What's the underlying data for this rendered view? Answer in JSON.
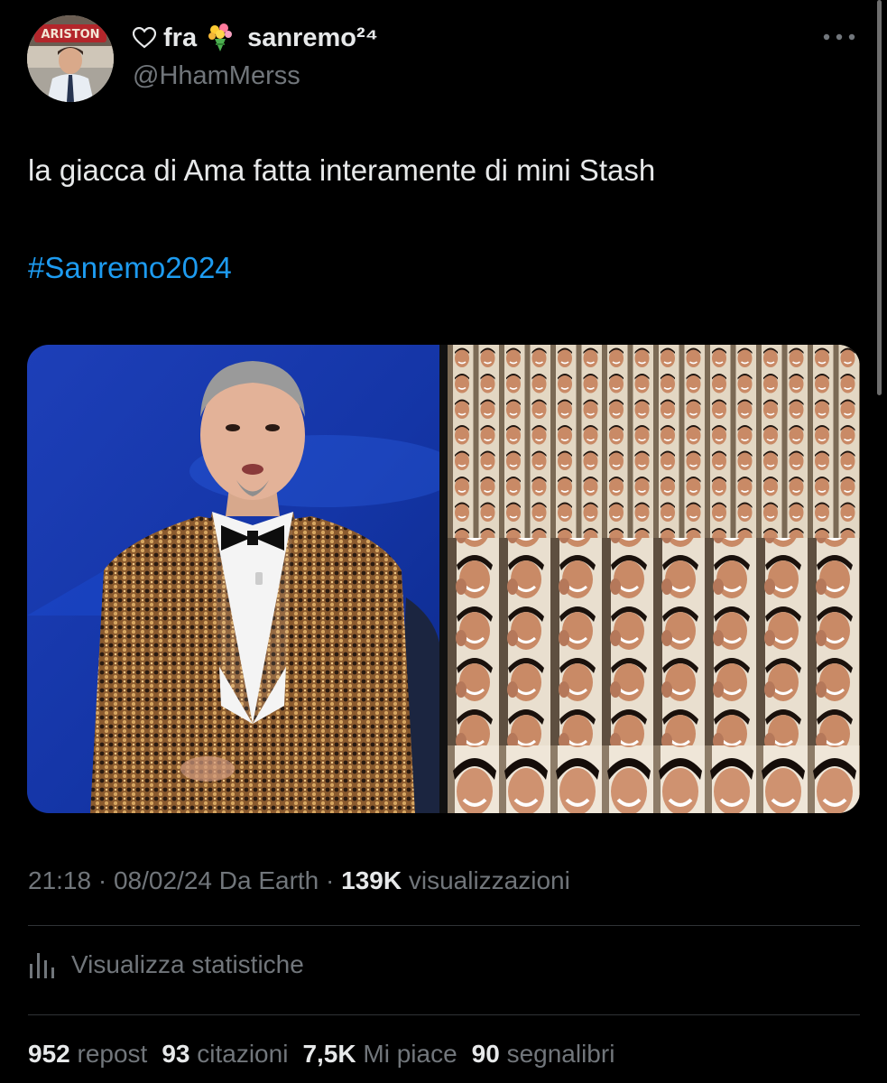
{
  "author": {
    "display_name_prefix": "fra",
    "display_name_suffix": "sanremo²⁴",
    "handle": "@HhamMerss",
    "avatar_sign_text": "ARISTON"
  },
  "tweet": {
    "text": "la giacca di Ama fatta interamente di mini Stash",
    "hashtag": "#Sanremo2024"
  },
  "meta": {
    "time": "21:18",
    "date": "08/02/24",
    "source": "Da Earth",
    "views_count": "139K",
    "views_label": "visualizzazioni",
    "separator": "·"
  },
  "actions": {
    "view_stats_label": "Visualizza statistiche"
  },
  "counts": {
    "reposts_value": "952",
    "reposts_label": "repost",
    "quotes_value": "93",
    "quotes_label": "citazioni",
    "likes_value": "7,5K",
    "likes_label": "Mi piace",
    "bookmarks_value": "90",
    "bookmarks_label": "segnalibri"
  },
  "colors": {
    "background": "#000000",
    "primary_text": "#e7e9ea",
    "secondary_text": "#71767b",
    "link": "#1d9bf0",
    "divider": "#2f3336"
  },
  "icons": [
    "heart-outline-icon",
    "bouquet-icon",
    "more-icon",
    "stats-icon"
  ]
}
